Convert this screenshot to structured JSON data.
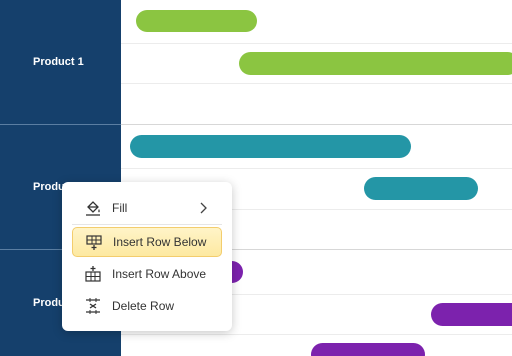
{
  "groups": [
    {
      "label": "Product 1"
    },
    {
      "label": "Produc"
    },
    {
      "label": "Produc"
    }
  ],
  "colors": {
    "sidebar": "#15406c",
    "green": "#8bc541",
    "teal": "#2496a6",
    "purple": "#7c22ad",
    "highlight": "#fde9a1"
  },
  "context_menu": {
    "items": [
      {
        "label": "Fill",
        "icon": "fill-bucket-icon",
        "has_submenu": true
      },
      {
        "label": "Insert Row Below",
        "icon": "insert-row-below-icon",
        "highlighted": true
      },
      {
        "label": "Insert Row Above",
        "icon": "insert-row-above-icon"
      },
      {
        "label": "Delete Row",
        "icon": "delete-row-icon"
      }
    ]
  }
}
